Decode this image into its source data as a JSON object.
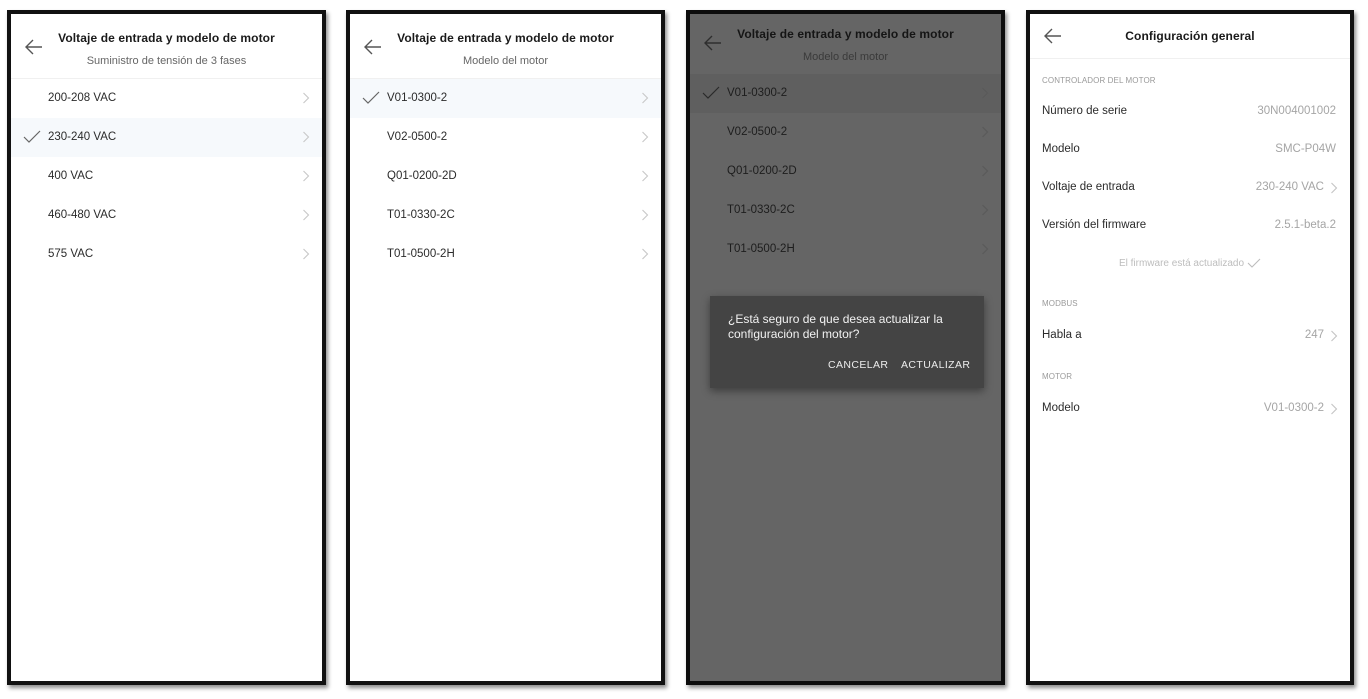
{
  "screens": {
    "voltage": {
      "title": "Voltaje de entrada y modelo de motor",
      "subtitle": "Suministro de tensión de 3 fases",
      "items": [
        {
          "label": "200-208 VAC"
        },
        {
          "label": "230-240 VAC",
          "selected": true
        },
        {
          "label": "400 VAC"
        },
        {
          "label": "460-480 VAC"
        },
        {
          "label": "575 VAC"
        }
      ]
    },
    "motor": {
      "title": "Voltaje de entrada y modelo de motor",
      "subtitle": "Modelo del motor",
      "items": [
        {
          "label": "V01-0300-2",
          "selected": true
        },
        {
          "label": "V02-0500-2"
        },
        {
          "label": "Q01-0200-2D"
        },
        {
          "label": "T01-0330-2C"
        },
        {
          "label": "T01-0500-2H"
        }
      ]
    },
    "confirm": {
      "title": "Voltaje de entrada y modelo de motor",
      "subtitle": "Modelo del motor",
      "items": [
        {
          "label": "V01-0300-2",
          "selected": true
        },
        {
          "label": "V02-0500-2"
        },
        {
          "label": "Q01-0200-2D"
        },
        {
          "label": "T01-0330-2C"
        },
        {
          "label": "T01-0500-2H"
        }
      ],
      "dialog": {
        "message": "¿Está seguro de que desea actualizar la configuración del motor?",
        "cancel": "CANCELAR",
        "confirm": "ACTUALIZAR"
      }
    },
    "settings": {
      "title": "Configuración general",
      "controller_section": "CONTROLADOR DEL MOTOR",
      "serial_label": "Número de serie",
      "serial_value": "30N004001002",
      "model_label": "Modelo",
      "model_value": "SMC-P04W",
      "voltage_label": "Voltaje de entrada",
      "voltage_value": "230-240 VAC",
      "firmware_label": "Versión del firmware",
      "firmware_value": "2.5.1-beta.2",
      "firmware_status": "El firmware está actualizado",
      "modbus_section": "MODBUS",
      "modbus_label": "Habla a",
      "modbus_value": "247",
      "motor_section": "MOTOR",
      "motor_model_label": "Modelo",
      "motor_model_value": "V01-0300-2"
    }
  },
  "icons": {
    "back": "arrow-left-icon",
    "chevron": "chevron-right-icon",
    "check": "checkmark-icon"
  }
}
